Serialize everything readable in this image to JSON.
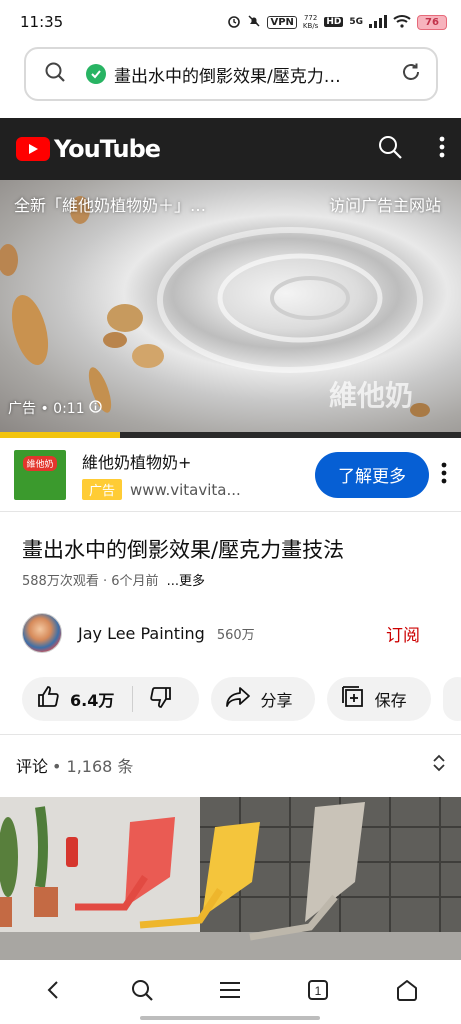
{
  "status_bar": {
    "time": "11:35",
    "vpn": "VPN",
    "net_speed_value": "772",
    "net_speed_unit": "KB/s",
    "hd": "HD",
    "signal_label": "5G",
    "battery": "76"
  },
  "browser": {
    "url_text": "畫出水中的倒影效果/壓克力…",
    "icons": [
      "search-icon",
      "shield-check-icon",
      "reload-icon"
    ]
  },
  "youtube_header": {
    "logo_text": "YouTube"
  },
  "video_ad": {
    "ad_title": "全新「維他奶植物奶＋」…",
    "visit_label": "访问广告主网站",
    "ad_time": "广告 • 0:11",
    "watermark": "維他奶",
    "progress_percent": 26
  },
  "ad_bar": {
    "thumb_text": "維他奶",
    "name": "維他奶植物奶+",
    "badge": "广告",
    "url": "www.vitavita...",
    "cta": "了解更多"
  },
  "video": {
    "title": "畫出水中的倒影效果/壓克力畫技法",
    "meta": "588万次观看 · 6个月前",
    "more": "...更多"
  },
  "channel": {
    "name": "Jay Lee Painting",
    "subscribers": "560万",
    "subscribe_label": "订阅"
  },
  "actions": {
    "like_count": "6.4万",
    "share_label": "分享",
    "save_label": "保存"
  },
  "comments": {
    "label": "评论",
    "count": "• 1,168 条"
  },
  "colors": {
    "brand_red": "#ff0000",
    "cta_blue": "#065fd4",
    "ad_yellow": "#ffcc35",
    "subscribe_red": "#cc0000",
    "progress_yellow": "#f2c40f"
  }
}
